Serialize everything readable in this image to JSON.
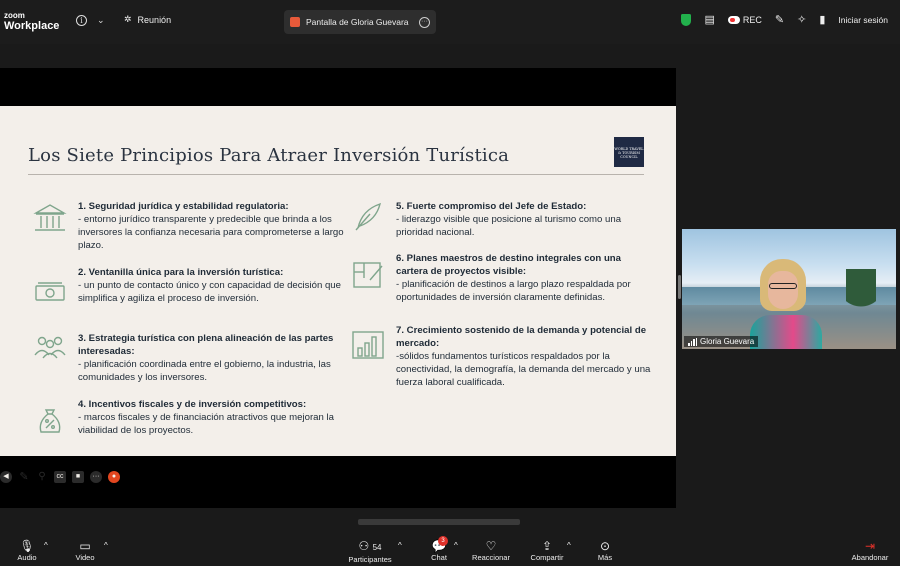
{
  "header": {
    "brand_small": "zoom",
    "brand_large": "Workplace",
    "meeting_label": "Reunión",
    "share_label": "Pantalla de Gloria Guevara",
    "rec_label": "REC",
    "signin_label": "Iniciar sesión"
  },
  "slide": {
    "title": "Los Siete Principios Para Atraer Inversión Turística",
    "logo_text": "WORLD TRAVEL & TOURISM COUNCIL",
    "items": [
      {
        "heading": "1.    Seguridad jurídica y estabilidad regulatoria:",
        "body": "- entorno jurídico transparente y predecible que brinda a los inversores la confianza necesaria para comprometerse a largo plazo."
      },
      {
        "heading": "2. Ventanilla única para la inversión turística:",
        "body": "- un punto de contacto único y con capacidad de decisión que simplifica y agiliza el proceso de inversión."
      },
      {
        "heading": "3. Estrategia turística con plena alineación de las partes interesadas:",
        "body": "- planificación coordinada entre el gobierno, la industria, las comunidades y los inversores."
      },
      {
        "heading": "4. Incentivos fiscales y de inversión competitivos:",
        "body": "- marcos fiscales y de financiación atractivos que mejoran la viabilidad de los proyectos."
      },
      {
        "heading": "5. Fuerte compromiso del Jefe de Estado:",
        "body": "- liderazgo visible que posicione al turismo como una prioridad nacional."
      },
      {
        "heading": "6. Planes maestros de destino integrales con una cartera de proyectos visible:",
        "body": "- planificación de destinos a largo plazo respaldada por oportunidades de inversión claramente definidas."
      },
      {
        "heading": "7. Crecimiento sostenido de la demanda y potencial de mercado:",
        "body": "-sólidos fundamentos turísticos respaldados por la conectividad, la demografía, la demanda del mercado y una fuerza laboral cualificada."
      }
    ]
  },
  "video": {
    "participant_name": "Gloria Guevara"
  },
  "toolbar": {
    "audio_label": "Audio",
    "video_label": "Video",
    "participants_label": "Participantes",
    "participants_count": "54",
    "chat_label": "Chat",
    "chat_badge": "3",
    "react_label": "Reaccionar",
    "share_label": "Compartir",
    "more_label": "Más",
    "leave_label": "Abandonar"
  },
  "colors": {
    "accent_green": "#22b14c",
    "leave_red": "#e0312a",
    "slide_bg": "#f3efea",
    "icon_green": "#7fa58c"
  }
}
